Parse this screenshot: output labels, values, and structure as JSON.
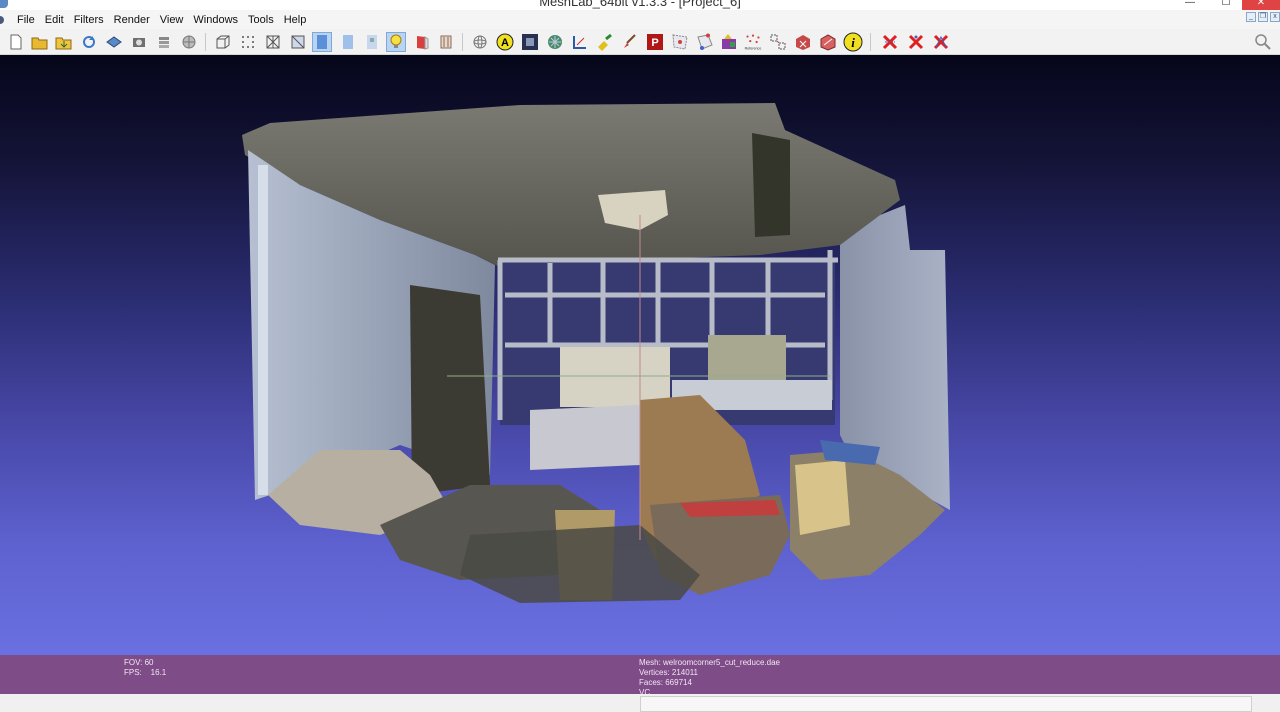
{
  "window": {
    "title": "MeshLab_64bit v1.3.3 - [Project_6]",
    "minimize": "—",
    "maximize": "☐",
    "close": "✕"
  },
  "menu": {
    "items": [
      {
        "label": "File"
      },
      {
        "label": "Edit"
      },
      {
        "label": "Filters"
      },
      {
        "label": "Render"
      },
      {
        "label": "View"
      },
      {
        "label": "Windows"
      },
      {
        "label": "Tools"
      },
      {
        "label": "Help"
      }
    ]
  },
  "toolbar": {
    "buttons": [
      {
        "icon": "new-project-icon"
      },
      {
        "icon": "open-project-icon"
      },
      {
        "icon": "import-mesh-icon"
      },
      {
        "icon": "reload-icon"
      },
      {
        "icon": "export-mesh-icon"
      },
      {
        "icon": "snapshot-icon"
      },
      {
        "icon": "layers-icon"
      },
      {
        "icon": "raster-icon"
      },
      {
        "icon": "bounding-box-icon"
      },
      {
        "icon": "points-icon"
      },
      {
        "icon": "wireframe-icon"
      },
      {
        "icon": "hidden-lines-icon"
      },
      {
        "icon": "flat-shading-icon"
      },
      {
        "icon": "smooth-shading-icon"
      },
      {
        "icon": "texture-icon"
      },
      {
        "icon": "light-bulb-icon"
      },
      {
        "icon": "back-face-icon"
      },
      {
        "icon": "color-icon"
      },
      {
        "icon": "trackball-icon"
      },
      {
        "icon": "annotation-icon"
      },
      {
        "icon": "selection-rect-icon"
      },
      {
        "icon": "texture-ball-icon"
      },
      {
        "icon": "measure-tool-icon"
      },
      {
        "icon": "paint-icon"
      },
      {
        "icon": "brush-icon"
      },
      {
        "icon": "pickpoints-icon"
      },
      {
        "icon": "select-faces-icon"
      },
      {
        "icon": "select-vertices-icon"
      },
      {
        "icon": "paint-color-icon"
      },
      {
        "icon": "reference-icon"
      },
      {
        "icon": "align-icon"
      },
      {
        "icon": "delete-selection-icon"
      },
      {
        "icon": "select-connected-icon"
      },
      {
        "icon": "info-icon"
      },
      {
        "icon": "delete-faces-icon"
      },
      {
        "icon": "delete-vertices-icon"
      },
      {
        "icon": "delete-all-icon"
      }
    ],
    "reference_label": "Reference",
    "colors": {
      "accent": "#e02020",
      "highlight": "#b9d3f0"
    }
  },
  "info": {
    "fov": "FOV: 60",
    "fps": "FPS:    16.1",
    "mesh": "Mesh: welroomcorner5_cut_reduce.dae",
    "vertices": "Vertices: 214011",
    "faces": "Faces: 669714",
    "vc": "VC"
  },
  "colors": {
    "infobar": "#7e4c86",
    "viewport_top": "#06061a",
    "viewport_bottom": "#6a70e0"
  }
}
